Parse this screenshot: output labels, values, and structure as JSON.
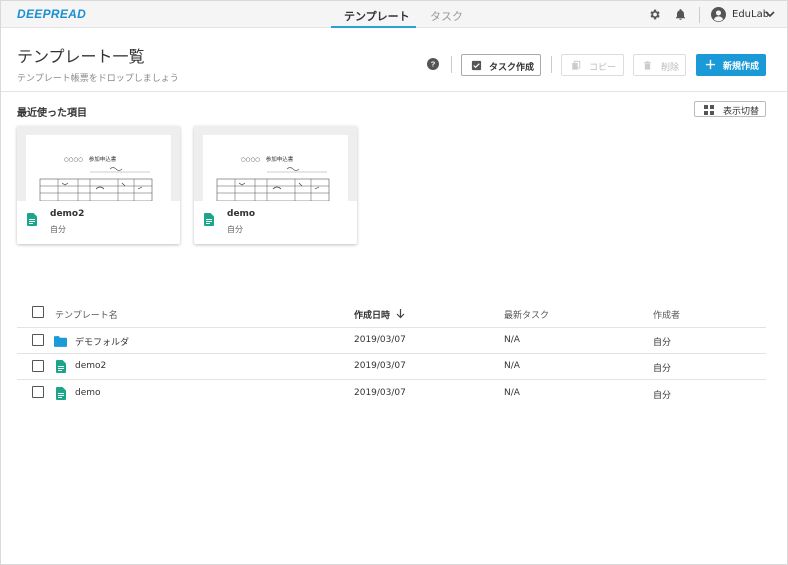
{
  "app": {
    "logo": "DEEPREAD"
  },
  "nav": {
    "tabs": [
      {
        "label": "テンプレート",
        "active": true
      },
      {
        "label": "タスク",
        "active": false
      }
    ]
  },
  "user": {
    "name": "EduLab"
  },
  "header": {
    "title": "テンプレート一覧",
    "subtitle": "テンプレート帳票をドロップしましょう",
    "buttons": {
      "task_create": "タスク作成",
      "copy": "コピー",
      "delete": "削除",
      "new": "新規作成"
    }
  },
  "recent": {
    "title": "最近使った項目",
    "toggle_view": "表示切替",
    "thumb_title": "○○○○　参加申込書",
    "cards": [
      {
        "name": "demo2",
        "owner": "自分"
      },
      {
        "name": "demo",
        "owner": "自分"
      }
    ]
  },
  "table": {
    "columns": {
      "name": "テンプレート名",
      "created": "作成日時",
      "latest_task": "最新タスク",
      "author": "作成者"
    },
    "rows": [
      {
        "type": "folder",
        "name": "デモフォルダ",
        "created": "2019/03/07",
        "latest_task": "N/A",
        "author": "自分"
      },
      {
        "type": "file",
        "name": "demo2",
        "created": "2019/03/07",
        "latest_task": "N/A",
        "author": "自分"
      },
      {
        "type": "file",
        "name": "demo",
        "created": "2019/03/07",
        "latest_task": "N/A",
        "author": "自分"
      }
    ]
  },
  "colors": {
    "accent": "#1a9ad6",
    "file_icon": "#1aa68a",
    "folder_icon": "#1a9ad6"
  }
}
